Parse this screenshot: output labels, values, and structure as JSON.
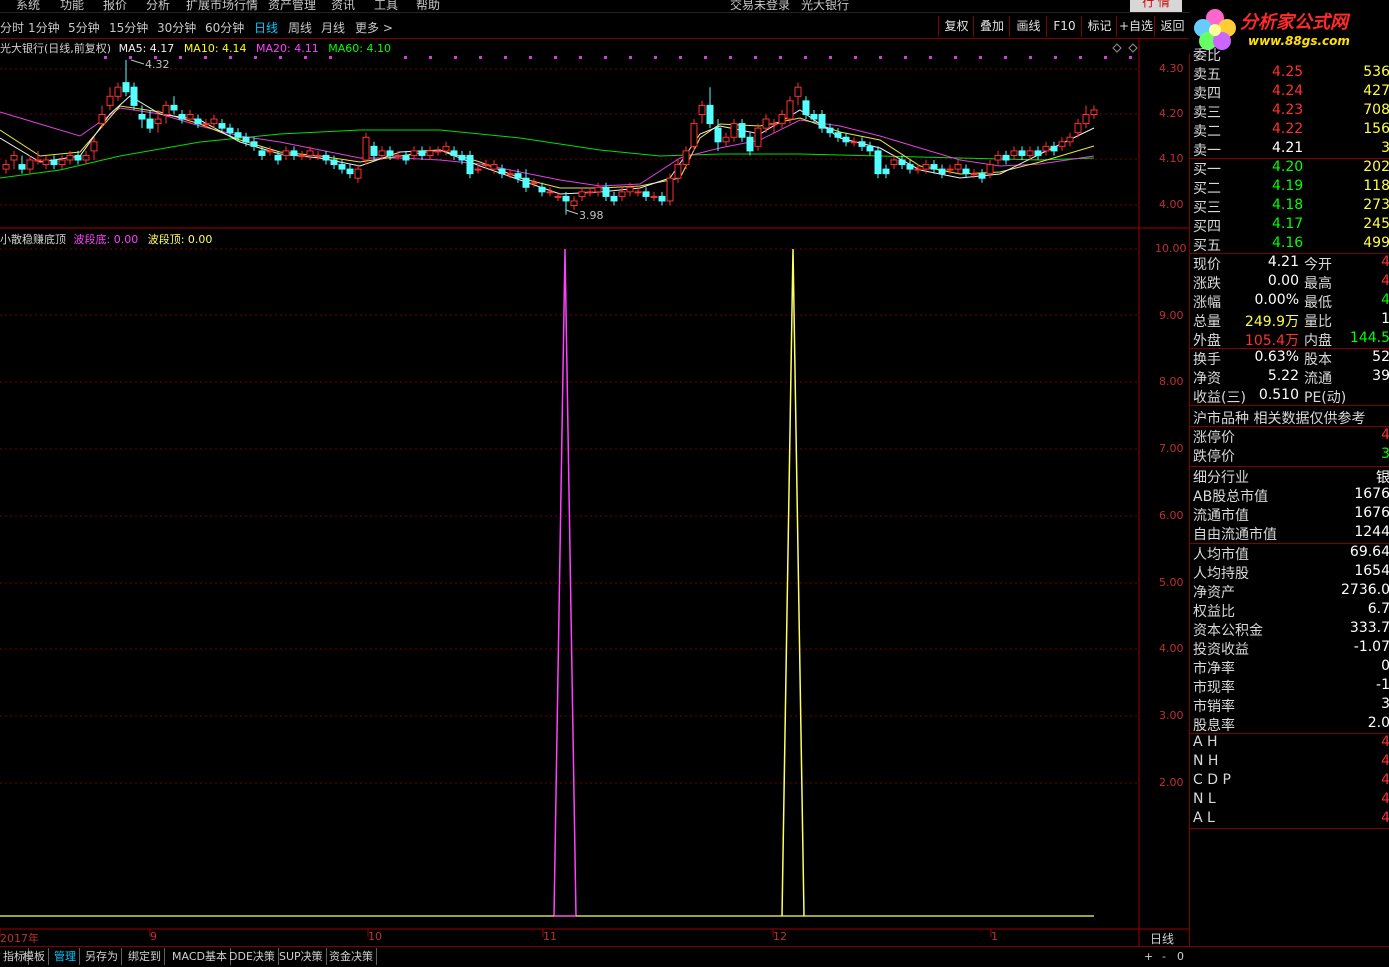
{
  "menubar": {
    "items": [
      "系统",
      "功能",
      "报价",
      "分析",
      "扩展市场行情",
      "资产管理",
      "资讯",
      "工具",
      "帮助"
    ],
    "login_status": "交易未登录",
    "stock_name": "光大银行",
    "hq_button": "行 情"
  },
  "toolbar": {
    "periods": [
      "分时",
      "1分钟",
      "5分钟",
      "15分钟",
      "30分钟",
      "60分钟",
      "日线",
      "周线",
      "月线",
      "更多 >"
    ],
    "active_period": "日线",
    "right_buttons": [
      "复权",
      "叠加",
      "画线",
      "F10",
      "标记",
      "+自选",
      "返回"
    ]
  },
  "logo": {
    "text": "分析家公式网",
    "url": "www.88gs.com"
  },
  "main_chart": {
    "title": "光大银行(日线,前复权)",
    "ma5": "MA5: 4.17",
    "ma10": "MA10: 4.14",
    "ma20": "MA20: 4.11",
    "ma60": "MA60: 4.10",
    "high_mark": "4.32",
    "low_mark": "3.98",
    "y_ticks": [
      "4.30",
      "4.20",
      "4.10",
      "4.00"
    ],
    "colors": {
      "ma5": "#ffffff",
      "ma10": "#ffff00",
      "ma20": "#ff40ff",
      "ma60": "#00ff00",
      "up": "#ff3030",
      "down": "#54ffff"
    }
  },
  "indicator": {
    "name": "小散稳赚底顶",
    "bottom_label": "波段底: 0.00",
    "top_label": "波段顶: 0.00",
    "y_ticks": [
      "10.00",
      "9.00",
      "8.00",
      "7.00",
      "6.00",
      "5.00",
      "4.00",
      "3.00",
      "2.00"
    ],
    "colors": {
      "bottom": "#ff40ff",
      "top": "#ffff60"
    }
  },
  "x_axis": {
    "labels": [
      "2017年",
      "9",
      "10",
      "11",
      "12",
      "1"
    ],
    "period_label": "日线"
  },
  "bottom_tabs": [
    "指标",
    "模板",
    "管理",
    "另存为",
    "绑定到",
    "MACD基本",
    "DDE决策",
    "SUP决策",
    "资金决策"
  ],
  "active_tab": "管理",
  "scroll_controls": [
    "+",
    "-",
    "0"
  ],
  "quote": {
    "top_label": "委比",
    "asks": [
      {
        "label": "卖五",
        "price": "4.25",
        "vol": "536"
      },
      {
        "label": "卖四",
        "price": "4.24",
        "vol": "427"
      },
      {
        "label": "卖三",
        "price": "4.23",
        "vol": "708"
      },
      {
        "label": "卖二",
        "price": "4.22",
        "vol": "156"
      },
      {
        "label": "卖一",
        "price": "4.21",
        "vol": "3"
      }
    ],
    "bids": [
      {
        "label": "买一",
        "price": "4.20",
        "vol": "202"
      },
      {
        "label": "买二",
        "price": "4.19",
        "vol": "118"
      },
      {
        "label": "买三",
        "price": "4.18",
        "vol": "273"
      },
      {
        "label": "买四",
        "price": "4.17",
        "vol": "245"
      },
      {
        "label": "买五",
        "price": "4.16",
        "vol": "499"
      }
    ],
    "stats": [
      {
        "l1": "现价",
        "v1": "4.21",
        "l2": "今开",
        "v2": "4"
      },
      {
        "l1": "涨跌",
        "v1": "0.00",
        "l2": "最高",
        "v2": "4"
      },
      {
        "l1": "涨幅",
        "v1": "0.00%",
        "l2": "最低",
        "v2": "4"
      },
      {
        "l1": "总量",
        "v1": "249.9万",
        "l2": "量比",
        "v2": "1"
      },
      {
        "l1": "外盘",
        "v1": "105.4万",
        "l2": "内盘",
        "v2": "144.5"
      }
    ],
    "fund": [
      {
        "l1": "换手",
        "v1": "0.63%",
        "l2": "股本",
        "v2": "52"
      },
      {
        "l1": "净资",
        "v1": "5.22",
        "l2": "流通",
        "v2": "39"
      },
      {
        "l1": "收益(三)",
        "v1": "0.510",
        "l2": "PE(动)",
        "v2": ""
      }
    ],
    "market_label": "沪市品种 相关数据仅供参考",
    "limits": [
      {
        "l": "涨停价",
        "v": "4"
      },
      {
        "l": "跌停价",
        "v": "3"
      }
    ],
    "company": [
      {
        "l": "细分行业",
        "v": "银"
      },
      {
        "l": "AB股总市值",
        "v": "1676"
      },
      {
        "l": "流通市值",
        "v": "1676"
      },
      {
        "l": "自由流通市值",
        "v": "1244"
      }
    ],
    "per_share": [
      {
        "l": "人均市值",
        "v": "69.64"
      },
      {
        "l": "人均持股",
        "v": "1654"
      },
      {
        "l": "净资产",
        "v": "2736.0"
      },
      {
        "l": "权益比",
        "v": "6.7"
      },
      {
        "l": "资本公积金",
        "v": "333.7"
      },
      {
        "l": "投资收益",
        "v": "-1.07"
      },
      {
        "l": "市净率",
        "v": "0"
      },
      {
        "l": "市现率",
        "v": "-1"
      },
      {
        "l": "市销率",
        "v": "3"
      },
      {
        "l": "股息率",
        "v": "2.0"
      }
    ],
    "levels": [
      {
        "l": "A H",
        "v": "4"
      },
      {
        "l": "N H",
        "v": "4"
      },
      {
        "l": "C D P",
        "v": "4"
      },
      {
        "l": "N L",
        "v": "4"
      },
      {
        "l": "A L",
        "v": "4"
      }
    ]
  }
}
